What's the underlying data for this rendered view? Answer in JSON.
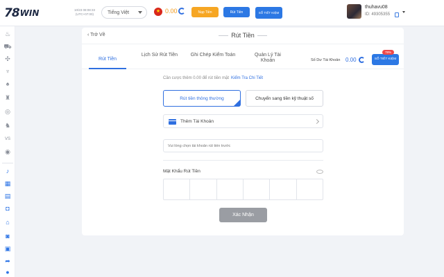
{
  "brand": {
    "logo_number": "78",
    "logo_word": "WIN"
  },
  "header": {
    "datetime": "10/23 08:08:33",
    "timezone": "(UTC+07:00)",
    "language": "Tiếng Việt",
    "balance": "0.00",
    "deposit_label": "Nạp Tiền",
    "withdraw_label": "Rút Tiền",
    "bet_history_label": "SỔ TIẾT KIỆM",
    "username": "thuhavu08",
    "user_id": "ID: 49305355",
    "colors": {
      "accent": "#2c78e4",
      "deposit": "#f6a623",
      "balance": "#f29a1a"
    }
  },
  "sidebar": {
    "icons": [
      "fire-icon",
      "car-icon",
      "crosshair-icon",
      "fish-icon",
      "cards-icon",
      "tower-icon",
      "soccer-icon",
      "rooster-icon",
      "vs-icon",
      "lottery-icon",
      "music-icon",
      "calendar-icon",
      "ticket-icon",
      "savings-icon",
      "house-icon",
      "camera-icon",
      "gift-icon",
      "share-icon",
      "chat-icon",
      "headset-icon"
    ]
  },
  "page": {
    "back_label": "Trở Về",
    "title": "Rút Tiền",
    "tabs": [
      {
        "label": "Rút Tiền",
        "active": true
      },
      {
        "label": "Lịch Sử Rút Tiền",
        "active": false
      },
      {
        "label": "Ghi Chép Kiểm Toán",
        "active": false
      },
      {
        "label": "Quản Lý Tài Khoản",
        "active": false
      }
    ],
    "balance_label": "Số Dư Tài Khoản",
    "balance_value": "0.00",
    "savings_button": "SỔ TIẾT KIỆM",
    "savings_badge": "78%",
    "bet_requirement": "Cần cược thêm 0.00 để rút tiền mặt",
    "bet_requirement_link": "Kiểm Tra Chi Tiết",
    "method_normal": "Rút tiền thông thường",
    "method_digital": "Chuyển sang tiền kỹ thuật số",
    "add_account": "Thêm Tài Khoản",
    "account_placeholder": "Vui lòng chọn tài khoản rút tiền trước",
    "password_label": "Mật Khẩu Rút Tiền",
    "confirm_label": "Xác Nhận"
  }
}
